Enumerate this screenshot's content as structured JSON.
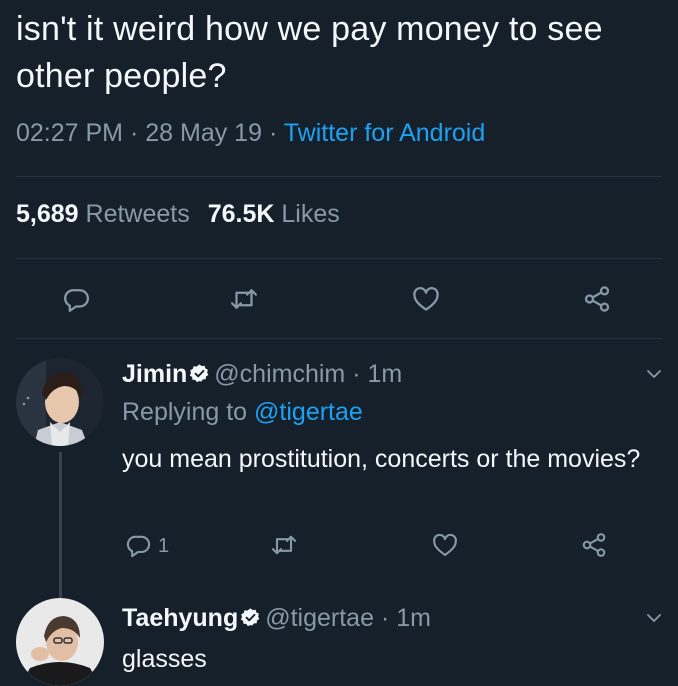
{
  "tweet": {
    "text": "isn't it weird how we pay money to see other people?",
    "time": "02:27 PM",
    "date": "28 May 19",
    "source": "Twitter for Android",
    "sep": "·",
    "retweets_count": "5,689",
    "retweets_label": "Retweets",
    "likes_count": "76.5K",
    "likes_label": "Likes"
  },
  "replies": [
    {
      "name": "Jimin",
      "handle": "@chimchim",
      "age": "· 1m",
      "replying_label": "Replying to",
      "replying_handle": "@tigertae",
      "text": "you mean prostitution, concerts or the movies?",
      "reply_count": "1"
    },
    {
      "name": "Taehyung",
      "handle": "@tigertae",
      "age": "· 1m",
      "text": "glasses"
    }
  ],
  "icons": {
    "reply": "reply-icon",
    "retweet": "retweet-icon",
    "like": "heart-icon",
    "share": "share-icon",
    "verified": "verified-badge-icon",
    "more": "chevron-down-icon"
  },
  "colors": {
    "background": "#15202b",
    "text": "#f5f8fa",
    "muted": "#8899a6",
    "accent": "#1da1f2"
  }
}
